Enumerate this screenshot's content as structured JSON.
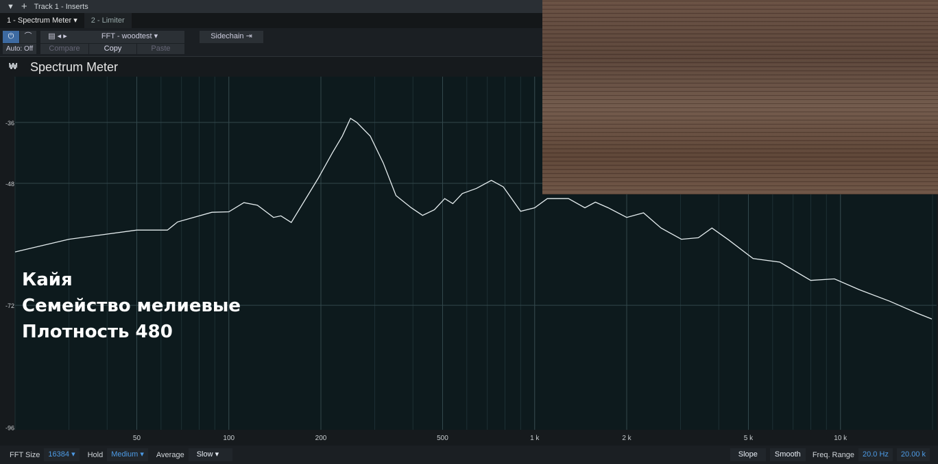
{
  "header": {
    "title": "Track 1 - Inserts"
  },
  "tabs": [
    {
      "label": "1 - Spectrum Meter"
    },
    {
      "label": "2 - Limiter"
    }
  ],
  "toolbar": {
    "auto": "Auto: Off",
    "preset": "FFT - woodtest",
    "sidechain": "Sidechain",
    "compare": "Compare",
    "copy": "Copy",
    "paste": "Paste"
  },
  "plugin_title": "Spectrum Meter",
  "caption": [
    "Кайя",
    "Семейство мелиевые",
    "Плотность 480"
  ],
  "bottom": {
    "fft_label": "FFT Size",
    "fft": "16384",
    "hold_label": "Hold",
    "hold": "Medium",
    "avg_label": "Average",
    "avg": "Slow",
    "slope": "Slope",
    "smooth": "Smooth",
    "range_label": "Freq. Range",
    "range_lo": "20.0 Hz",
    "range_hi": "20.00 k"
  },
  "chart_data": {
    "type": "line",
    "xscale": "log",
    "xlim": [
      20,
      20000
    ],
    "ylim": [
      -96.5,
      -27
    ],
    "xticks": [
      {
        "v": 50,
        "l": "50"
      },
      {
        "v": 100,
        "l": "100"
      },
      {
        "v": 200,
        "l": "200"
      },
      {
        "v": 500,
        "l": "500"
      },
      {
        "v": 1000,
        "l": "1 k"
      },
      {
        "v": 2000,
        "l": "2 k"
      },
      {
        "v": 5000,
        "l": "5 k"
      },
      {
        "v": 10000,
        "l": "10 k"
      }
    ],
    "yticks": [
      {
        "v": -36,
        "l": "-36"
      },
      {
        "v": -48,
        "l": "-48"
      },
      {
        "v": -72,
        "l": "-72"
      },
      {
        "v": -96,
        "l": "-96"
      }
    ],
    "line_color": "#e6eef0",
    "background": "#0d1a1d",
    "x": [
      20,
      30,
      50,
      63,
      68,
      88,
      100,
      112,
      124,
      140,
      148,
      160,
      196,
      218,
      235,
      250,
      262,
      290,
      320,
      352,
      395,
      430,
      470,
      508,
      540,
      580,
      645,
      722,
      790,
      900,
      1000,
      1100,
      1290,
      1460,
      1580,
      1740,
      2000,
      2270,
      2590,
      3020,
      3430,
      3800,
      4300,
      5180,
      6330,
      7990,
      9560,
      11500,
      14500,
      17900,
      19900
    ],
    "y": [
      -61.5,
      -59,
      -57.2,
      -57.2,
      -55.6,
      -53.7,
      -53.6,
      -51.8,
      -52.3,
      -54.7,
      -54.4,
      -55.7,
      -47,
      -42,
      -38.7,
      -35.2,
      -36,
      -38.7,
      -44,
      -50.4,
      -52.8,
      -54.3,
      -53.2,
      -51,
      -52,
      -50,
      -49,
      -47.4,
      -48.7,
      -53.5,
      -52.8,
      -51,
      -51,
      -52.8,
      -51.7,
      -52.8,
      -54.7,
      -53.8,
      -56.8,
      -59,
      -58.7,
      -56.8,
      -59.1,
      -62.8,
      -63.5,
      -67.1,
      -66.8,
      -68.9,
      -71.2,
      -73.6,
      -74.7
    ]
  }
}
